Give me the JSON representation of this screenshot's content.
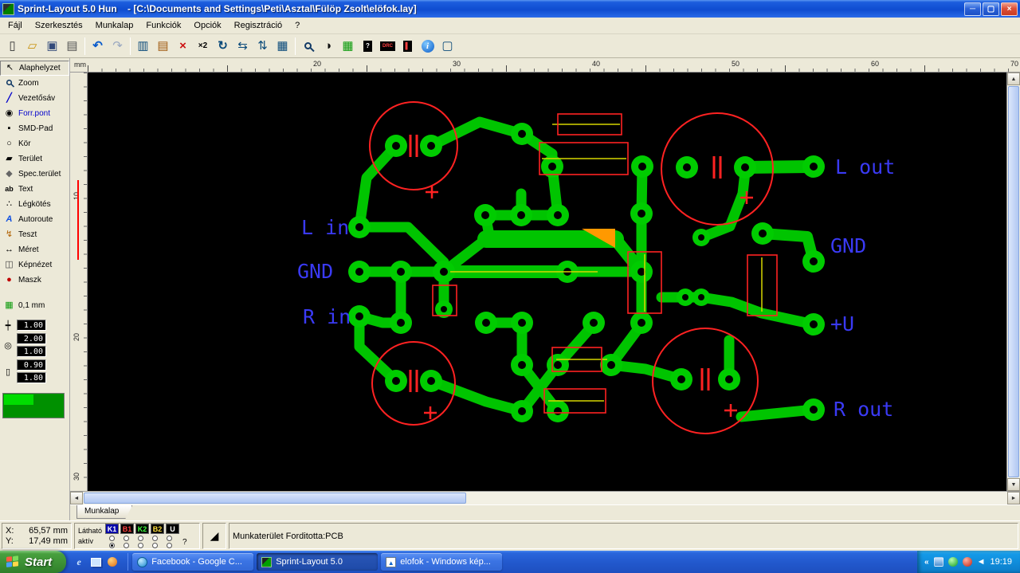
{
  "window": {
    "app_title": "Sprint-Layout 5.0 Hun",
    "doc_path": "- [C:\\Documents and Settings\\Peti\\Asztal\\Fülöp Zsolt\\elöfok.lay]",
    "min_glyph": "─",
    "max_glyph": "▢",
    "close_glyph": "×"
  },
  "menu": {
    "items": [
      "Fájl",
      "Szerkesztés",
      "Munkalap",
      "Funkciók",
      "Opciók",
      "Regisztráció",
      "?"
    ]
  },
  "toolbar": {
    "icons": [
      {
        "name": "new-document",
        "glyph": "▯"
      },
      {
        "name": "open-folder",
        "glyph": "▱"
      },
      {
        "name": "save",
        "glyph": "▣"
      },
      {
        "name": "print",
        "glyph": "▤"
      },
      {
        "name": "undo",
        "glyph": "↶"
      },
      {
        "name": "redo",
        "glyph": "↷"
      },
      {
        "name": "copy",
        "glyph": "▥"
      },
      {
        "name": "paste",
        "glyph": "▤"
      },
      {
        "name": "delete",
        "glyph": "×"
      },
      {
        "name": "duplicate-x2",
        "glyph": "×2"
      },
      {
        "name": "rotate",
        "glyph": "↻"
      },
      {
        "name": "mirror-horizontal",
        "glyph": "⇆"
      },
      {
        "name": "mirror-vertical",
        "glyph": "⇅"
      },
      {
        "name": "align-grid",
        "glyph": "▦"
      },
      {
        "name": "zoom",
        "glyph": ""
      },
      {
        "name": "photo-view",
        "glyph": "◑"
      },
      {
        "name": "capture-grid",
        "glyph": "▦"
      },
      {
        "name": "macro",
        "glyph": "?"
      },
      {
        "name": "drc",
        "glyph": "DRC"
      },
      {
        "name": "footprint",
        "glyph": "▌"
      },
      {
        "name": "info",
        "glyph": "i"
      },
      {
        "name": "select-frame",
        "glyph": "▢"
      }
    ]
  },
  "sidebar": {
    "tools": [
      {
        "name": "pointer",
        "glyph": "↖",
        "label": "Alaphelyzet"
      },
      {
        "name": "zoom",
        "glyph": "",
        "label": "Zoom"
      },
      {
        "name": "track",
        "glyph": "╱",
        "label": "Vezetősáv"
      },
      {
        "name": "solder-pad",
        "glyph": "◉",
        "label": "Forr.pont"
      },
      {
        "name": "smd-pad",
        "glyph": "▪",
        "label": "SMD-Pad"
      },
      {
        "name": "circle",
        "glyph": "○",
        "label": "Kör"
      },
      {
        "name": "zone",
        "glyph": "▰",
        "label": "Terület"
      },
      {
        "name": "special-zone",
        "glyph": "◆",
        "label": "Spec.terület"
      },
      {
        "name": "text",
        "glyph": "ab",
        "label": "Text"
      },
      {
        "name": "ratsnest",
        "glyph": "∴",
        "label": "Légkötés"
      },
      {
        "name": "autoroute",
        "glyph": "A",
        "label": "Autoroute"
      },
      {
        "name": "test",
        "glyph": "↯",
        "label": "Teszt"
      },
      {
        "name": "dimension",
        "glyph": "↔",
        "label": "Méret"
      },
      {
        "name": "photo-view",
        "glyph": "◫",
        "label": "Képnézet"
      },
      {
        "name": "mask",
        "glyph": "●",
        "label": "Maszk"
      }
    ],
    "grid": {
      "glyph": "▦",
      "label": "0,1 mm"
    },
    "fields": {
      "track_width": "1.00",
      "pad_outer": "2.00",
      "pad_drill": "1.00",
      "smd_width": "0.90",
      "smd_height": "1.80"
    }
  },
  "rulers": {
    "unit": "mm",
    "top": [
      "20",
      "30",
      "40",
      "50",
      "60",
      "70"
    ],
    "left": [
      "10",
      "20",
      "30"
    ]
  },
  "pcb": {
    "labels": {
      "l_in": "L in",
      "gnd_left": "GND",
      "r_in": "R in",
      "l_out": "L out",
      "gnd_right": "GND",
      "plus_u": "+U",
      "r_out": "R out"
    }
  },
  "sheet_tab": "Munkalap",
  "status": {
    "x_label": "X:",
    "x_value": "65,57 mm",
    "y_label": "Y:",
    "y_value": "17,49 mm",
    "visible_label": "Látható",
    "active_label": "aktív",
    "layers": [
      "K1",
      "B1",
      "K2",
      "B2",
      "U"
    ],
    "help": "?",
    "info": "Munkaterület   Forditotta:PCB"
  },
  "taskbar": {
    "start": "Start",
    "windows": [
      "Facebook - Google C...",
      "Sprint-Layout 5.0",
      "elofok - Windows kép..."
    ],
    "clock": "19:19"
  }
}
